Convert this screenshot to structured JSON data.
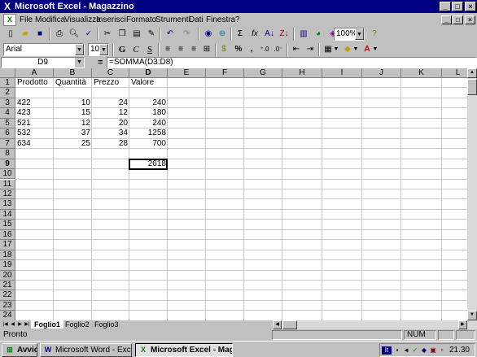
{
  "window": {
    "title": "Microsoft Excel - Magazzino",
    "controls": {
      "minimize": "_",
      "maximize": "□",
      "close": "×"
    }
  },
  "menu": {
    "items": [
      "File",
      "Modifica",
      "Visualizza",
      "Inserisci",
      "Formato",
      "Strumenti",
      "Dati",
      "Finestra",
      "?"
    ]
  },
  "toolbar_standard": {
    "zoom": "100%",
    "sum_symbol": "Σ",
    "function_symbol": "fx"
  },
  "toolbar_format": {
    "font": "Arial",
    "size": "10",
    "bold": "G",
    "italic": "C",
    "underline": "S",
    "percent": "%",
    "thousands": ","
  },
  "formula_bar": {
    "name_box": "D9",
    "equals": "=",
    "formula": "=SOMMA(D3:D8)"
  },
  "sheet": {
    "columns": [
      "A",
      "B",
      "C",
      "D",
      "E",
      "F",
      "G",
      "H",
      "I",
      "J",
      "K",
      "L"
    ],
    "rows": [
      "1",
      "2",
      "3",
      "4",
      "5",
      "6",
      "7",
      "8",
      "9",
      "10",
      "11",
      "12",
      "13",
      "14",
      "15",
      "16",
      "17",
      "18",
      "19",
      "20",
      "21",
      "22",
      "23",
      "24"
    ],
    "headers": {
      "a": "Prodotto",
      "b": "Quantità",
      "c": "Prezzo",
      "d": "Valore"
    },
    "data": [
      {
        "a": "422",
        "b": "10",
        "c": "24",
        "d": "240"
      },
      {
        "a": "423",
        "b": "15",
        "c": "12",
        "d": "180"
      },
      {
        "a": "521",
        "b": "12",
        "c": "20",
        "d": "240"
      },
      {
        "a": "532",
        "b": "37",
        "c": "34",
        "d": "1258"
      },
      {
        "a": "634",
        "b": "25",
        "c": "28",
        "d": "700"
      }
    ],
    "total": "2618",
    "selected_cell": "D9"
  },
  "tabs": [
    "Foglio1",
    "Foglio2",
    "Foglio3"
  ],
  "status": {
    "ready": "Pronto",
    "num": "NUM"
  },
  "taskbar": {
    "start": "Avvio",
    "tasks": [
      "Microsoft Word - Excel",
      "Microsoft Excel - Magg..."
    ],
    "tray_lang": "It",
    "clock": "21.30"
  }
}
